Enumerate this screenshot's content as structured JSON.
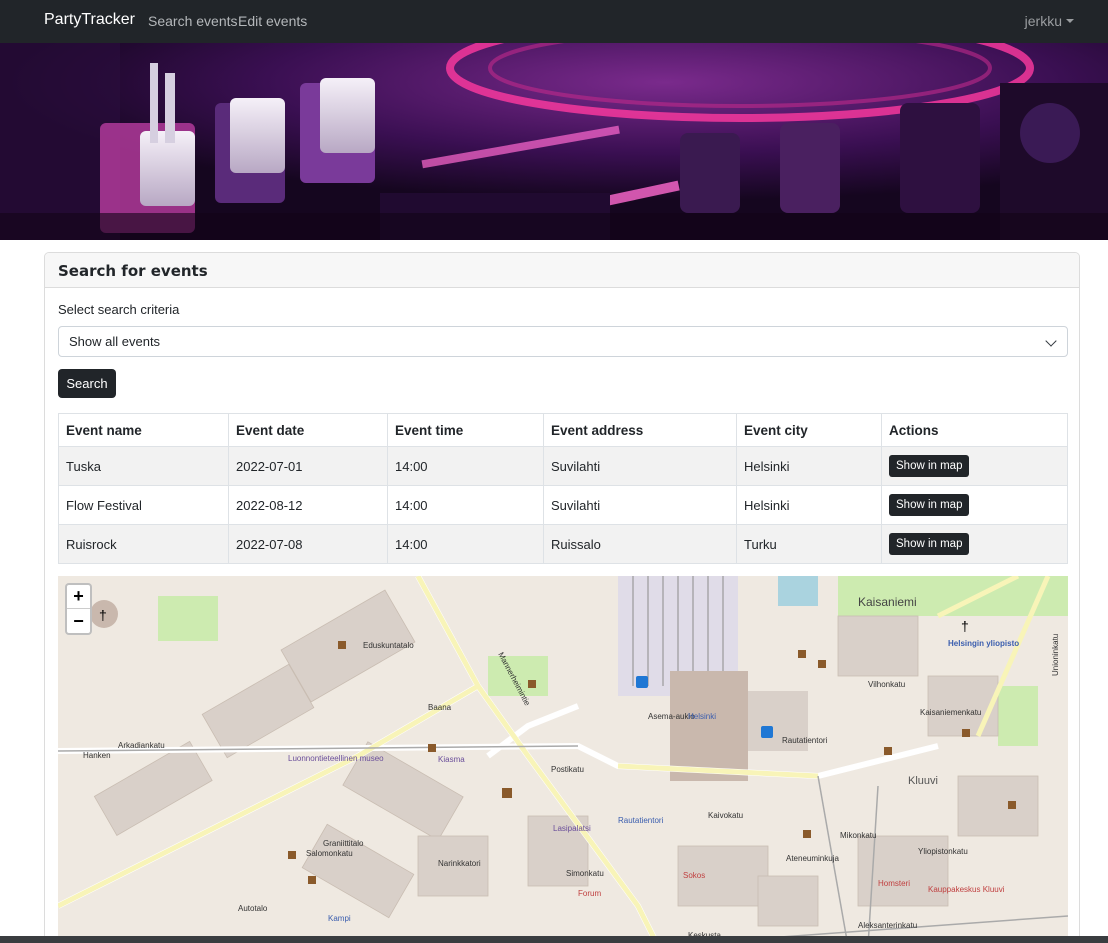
{
  "navbar": {
    "brand": "PartyTracker",
    "links": [
      "Search events",
      "Edit events"
    ],
    "user": "jerkku",
    "icons": {
      "user_menu": "caret-down-icon"
    }
  },
  "card": {
    "title": "Search for events",
    "criteria_label": "Select search criteria",
    "select_value": "Show all events",
    "search_button": "Search"
  },
  "table": {
    "headers": [
      "Event name",
      "Event date",
      "Event time",
      "Event address",
      "Event city",
      "Actions"
    ],
    "rows": [
      {
        "name": "Tuska",
        "date": "2022-07-01",
        "time": "14:00",
        "address": "Suvilahti",
        "city": "Helsinki",
        "action": "Show in map"
      },
      {
        "name": "Flow Festival",
        "date": "2022-08-12",
        "time": "14:00",
        "address": "Suvilahti",
        "city": "Helsinki",
        "action": "Show in map"
      },
      {
        "name": "Ruisrock",
        "date": "2022-07-08",
        "time": "14:00",
        "address": "Ruissalo",
        "city": "Turku",
        "action": "Show in map"
      }
    ]
  },
  "map": {
    "zoom_in": "+",
    "zoom_out": "−",
    "labels": {
      "eduskuntatalo": "Eduskuntatalo",
      "asema_aukio": "Asema-aukio",
      "helsinki": "Helsinki",
      "rautatientori": "Rautatientori",
      "kaisaniemi": "Kaisaniemi",
      "helsingin_yliopisto": "Helsingin yliopisto",
      "narinkkatori": "Narinkkatori",
      "kluuvi": "Kluuvi",
      "kamppi": "Kampi",
      "arkadiankatu": "Arkadiankatu",
      "postikatu": "Postikatu",
      "kaivokatu": "Kaivokatu",
      "mannerheimintie": "Mannerheimintie",
      "autotalo": "Autotalo",
      "grani": "Graniittitalo",
      "keskusta": "Keskusta",
      "hanken": "Hanken",
      "museo": "Luonnontieteellinen museo",
      "kiasma": "Kiasma",
      "aleksanterinkatu": "Aleksanterinkatu",
      "kaisaniemenkatu": "Kaisaniemenkatu",
      "vilhonkatu": "Vilhonkatu",
      "yliopistonkatu": "Yliopistonkatu",
      "unioninkatu": "Unioninkatu",
      "kampinkatu": "Salomonkatu",
      "simonkatu": "Simonkatu",
      "forum": "Forum",
      "sokos": "Sokos",
      "kauppakeskus": "Kauppakeskus Kluuvi",
      "homsteri": "Homsteri",
      "ateneum": "Ateneuminkuja",
      "mikonkatu": "Mikonkatu",
      "lasipalatsi": "Lasipalatsi",
      "baana": "Baana"
    }
  },
  "colors": {
    "navbar": "#212529",
    "button": "#212529",
    "accent": "#ffffff"
  }
}
